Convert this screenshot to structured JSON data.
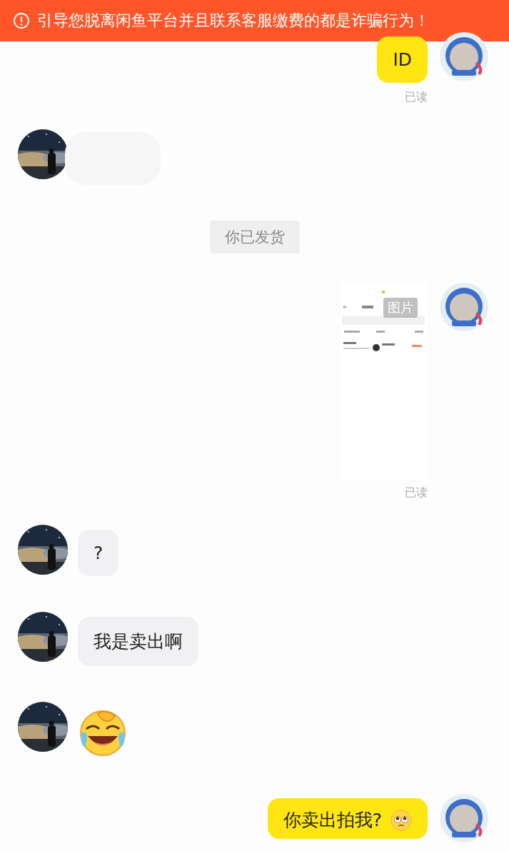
{
  "warning_banner": {
    "text": "引导您脱离闲鱼平台并且联系客服缴费的都是诈骗行为！"
  },
  "messages": [
    {
      "kind": "text",
      "outgoing": true,
      "text": "ID",
      "receipt": "已读"
    },
    {
      "kind": "redacted",
      "outgoing": false
    },
    {
      "kind": "system",
      "text": "你已发货"
    },
    {
      "outgoing": true,
      "label": "图片",
      "receipt": "已读"
    },
    {
      "kind": "text",
      "outgoing": false,
      "text": "?"
    },
    {
      "kind": "text",
      "outgoing": false,
      "text": "我是卖出啊"
    },
    {
      "kind": "sticker",
      "outgoing": false
    },
    {
      "kind": "text_emoji",
      "outgoing": true,
      "text": "你卖出拍我?"
    }
  ]
}
